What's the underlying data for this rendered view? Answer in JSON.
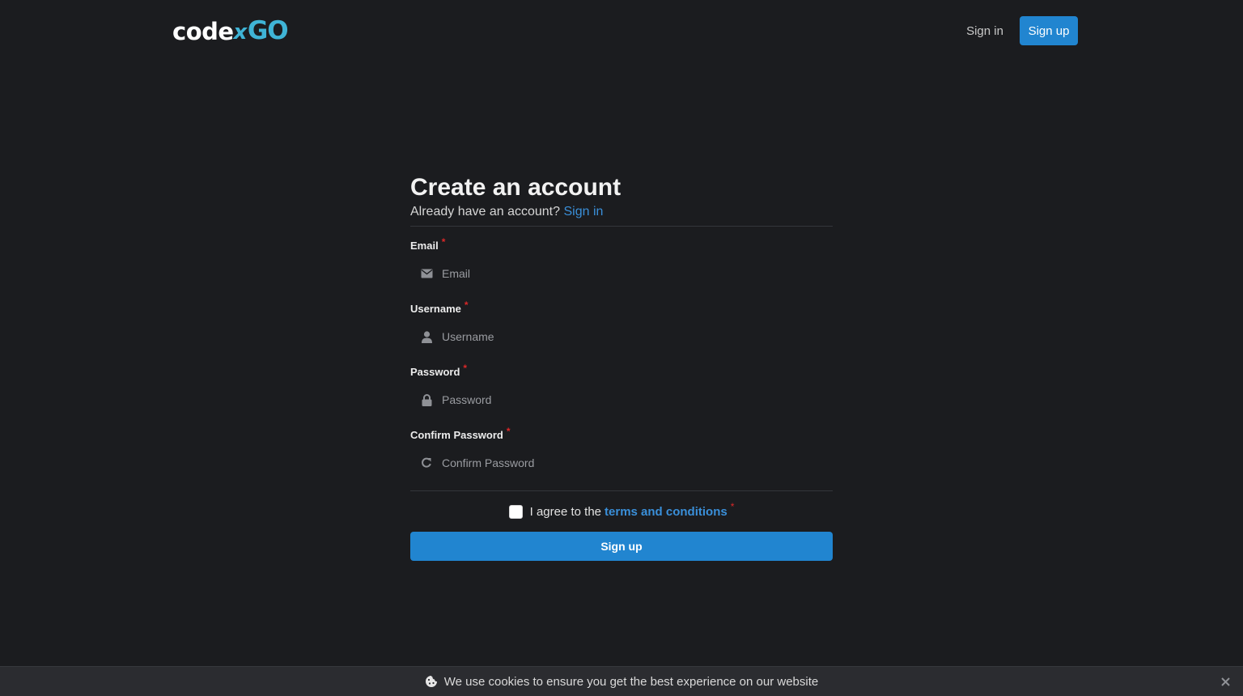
{
  "header": {
    "logo": {
      "part1": "code",
      "part2": "x",
      "part3": "GO"
    },
    "nav": {
      "signin": "Sign in",
      "signup": "Sign up"
    }
  },
  "form": {
    "title": "Create an account",
    "subtitle_text": "Already have an account?",
    "subtitle_link": "Sign in",
    "required_mark": "*",
    "fields": [
      {
        "label": "Email",
        "placeholder": "Email",
        "icon": "envelope-icon"
      },
      {
        "label": "Username",
        "placeholder": "Username",
        "icon": "user-icon"
      },
      {
        "label": "Password",
        "placeholder": "Password",
        "icon": "lock-icon"
      },
      {
        "label": "Confirm Password",
        "placeholder": "Confirm Password",
        "icon": "refresh-icon"
      }
    ],
    "agree_text": "I agree to the",
    "agree_link": "terms and conditions",
    "submit": "Sign up"
  },
  "cookie": {
    "text": "We use cookies to ensure you get the best experience on our website",
    "icon": "cookie-icon",
    "close_icon": "close-icon"
  },
  "colors": {
    "background": "#1b1c1f",
    "primary": "#2185d0",
    "link": "#3a8fd9",
    "logo_accent": "#3fb4d6",
    "required": "#db2828"
  }
}
